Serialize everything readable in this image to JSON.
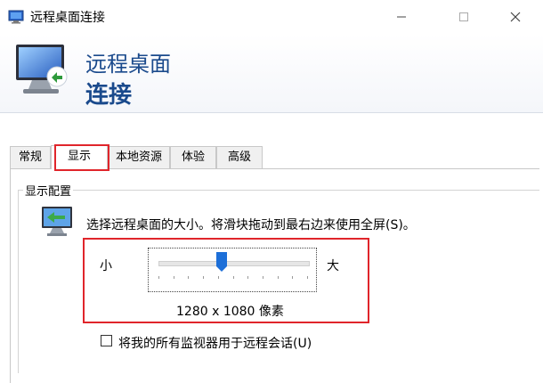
{
  "window": {
    "title": "远程桌面连接"
  },
  "banner": {
    "line1": "远程桌面",
    "line2": "连接"
  },
  "tabs": [
    {
      "label": "常规",
      "selected": false
    },
    {
      "label": "显示",
      "selected": true
    },
    {
      "label": "本地资源",
      "selected": false
    },
    {
      "label": "体验",
      "selected": false
    },
    {
      "label": "高级",
      "selected": false
    }
  ],
  "display": {
    "group_title": "显示配置",
    "instruction": "选择远程桌面的大小。将滑块拖动到最右边来使用全屏(S)。",
    "slider": {
      "min_label": "小",
      "max_label": "大",
      "value_fraction": 0.42
    },
    "resolution": "1280 x 1080 像素",
    "use_all_monitors": {
      "label": "将我的所有监视器用于远程会话(U)",
      "checked": false
    }
  },
  "colors": {
    "banner_text": "#1a4a8c",
    "highlight": "#e0252b",
    "slider_thumb": "#1d6fd8"
  },
  "icons": {
    "app": "remote-desktop-icon",
    "minimize": "minimize-icon",
    "maximize": "maximize-icon",
    "close": "close-icon",
    "display_monitor": "monitor-icon"
  }
}
